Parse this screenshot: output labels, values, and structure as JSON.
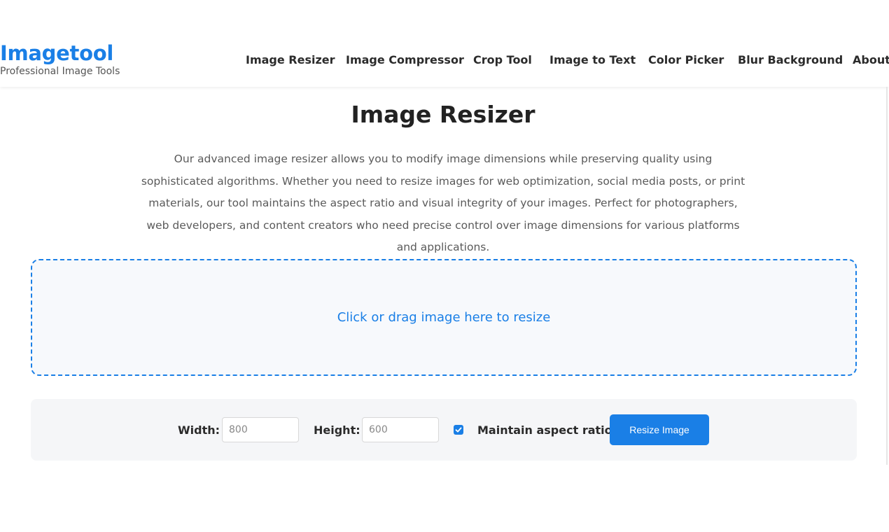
{
  "brand": {
    "title": "Imagetool",
    "subtitle": "Professional Image Tools",
    "accent_color": "#1a7fe6"
  },
  "nav": {
    "items": [
      {
        "label": "Image Resizer"
      },
      {
        "label": "Image Compressor"
      },
      {
        "label": "Crop Tool"
      },
      {
        "label": "Image to Text"
      },
      {
        "label": "Color Picker"
      },
      {
        "label": "Blur Background"
      },
      {
        "label": "About"
      }
    ]
  },
  "main": {
    "title": "Image Resizer",
    "intro": "Our advanced image resizer allows you to modify image dimensions while preserving quality using sophisticated algorithms. Whether you need to resize images for web optimization, social media posts, or print materials, our tool maintains the aspect ratio and visual integrity of your images. Perfect for photographers, web developers, and content creators who need precise control over image dimensions for various platforms and applications.",
    "dropzone_text": "Click or drag image here to resize"
  },
  "controls": {
    "width_label": "Width:",
    "width_placeholder": "800",
    "height_label": "Height:",
    "height_placeholder": "600",
    "aspect_label": "Maintain aspect ratio",
    "aspect_checked": true,
    "checkbox_icon": "checkmark-icon",
    "resize_button": "Resize Image"
  }
}
